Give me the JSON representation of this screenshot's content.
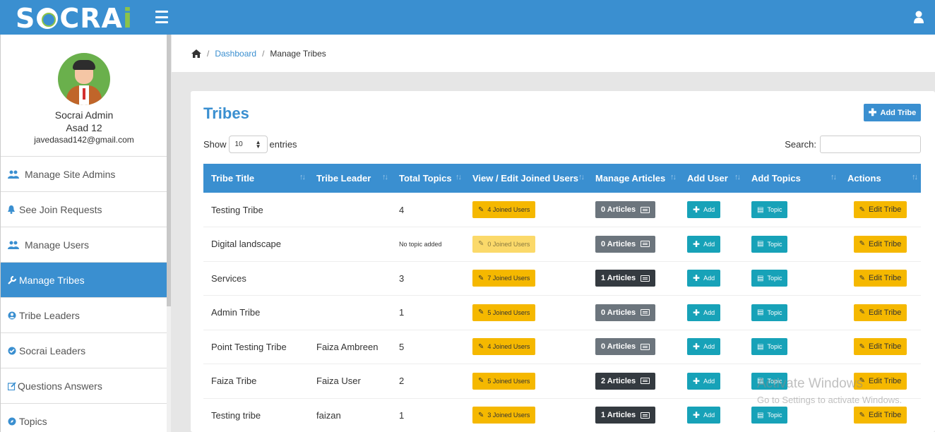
{
  "header": {
    "logo_prefix": "S",
    "logo_middle": "CR",
    "logo_a": "A",
    "logo_i": "i"
  },
  "profile": {
    "name": "Socrai Admin",
    "line2": "Asad 12",
    "email": "javedasad142@gmail.com"
  },
  "sidebar": {
    "items": [
      {
        "label": "Manage Site Admins",
        "icon": "users-icon"
      },
      {
        "label": "See Join Requests",
        "icon": "bell-icon"
      },
      {
        "label": "Manage Users",
        "icon": "users-icon"
      },
      {
        "label": "Manage Tribes",
        "icon": "wrench-icon"
      },
      {
        "label": "Tribe Leaders",
        "icon": "user-circle-icon"
      },
      {
        "label": "Socrai Leaders",
        "icon": "check-circle-icon"
      },
      {
        "label": "Questions Answers",
        "icon": "edit-icon"
      },
      {
        "label": "Topics",
        "icon": "compass-icon"
      }
    ]
  },
  "breadcrumb": {
    "dashboard": "Dashboard",
    "current": "Manage Tribes"
  },
  "card": {
    "title": "Tribes",
    "add_button": "Add Tribe",
    "show_label": "Show",
    "entries_value": "10",
    "entries_label": "entries",
    "search_label": "Search:"
  },
  "table": {
    "headers": [
      "Tribe Title",
      "Tribe Leader",
      "Total Topics",
      "View / Edit Joined Users",
      "Manage Articles",
      "Add User",
      "Add Topics",
      "Actions"
    ],
    "rows": [
      {
        "title": "Testing Tribe",
        "leader": "",
        "topics": "4",
        "joined": "4 Joined Users",
        "articles": "0 Articles",
        "add_user": "Add",
        "topic": "Topic",
        "edit": "Edit Tribe"
      },
      {
        "title": "Digital landscape",
        "leader": "",
        "topics": "No topic added",
        "joined": "0 Joined Users",
        "articles": "0 Articles",
        "add_user": "Add",
        "topic": "Topic",
        "edit": "Edit Tribe"
      },
      {
        "title": "Services",
        "leader": "",
        "topics": "3",
        "joined": "7 Joined Users",
        "articles": "1 Articles",
        "add_user": "Add",
        "topic": "Topic",
        "edit": "Edit Tribe"
      },
      {
        "title": "Admin Tribe",
        "leader": "",
        "topics": "1",
        "joined": "5 Joined Users",
        "articles": "0 Articles",
        "add_user": "Add",
        "topic": "Topic",
        "edit": "Edit Tribe"
      },
      {
        "title": "Point Testing Tribe",
        "leader": "Faiza Ambreen",
        "topics": "5",
        "joined": "4 Joined Users",
        "articles": "0 Articles",
        "add_user": "Add",
        "topic": "Topic",
        "edit": "Edit Tribe"
      },
      {
        "title": "Faiza Tribe",
        "leader": "Faiza User",
        "topics": "2",
        "joined": "5 Joined Users",
        "articles": "2 Articles",
        "add_user": "Add",
        "topic": "Topic",
        "edit": "Edit Tribe"
      },
      {
        "title": "Testing tribe",
        "leader": "faizan",
        "topics": "1",
        "joined": "3 Joined Users",
        "articles": "1 Articles",
        "add_user": "Add",
        "topic": "Topic",
        "edit": "Edit Tribe"
      }
    ]
  },
  "watermark": {
    "line1": "Activate Windows",
    "line2": "Go to Settings to activate Windows."
  },
  "colors": {
    "primary": "#3a8fd0",
    "warning": "#f5b800",
    "info": "#17a2b8",
    "secondary": "#6c757d",
    "dark": "#343a40"
  }
}
